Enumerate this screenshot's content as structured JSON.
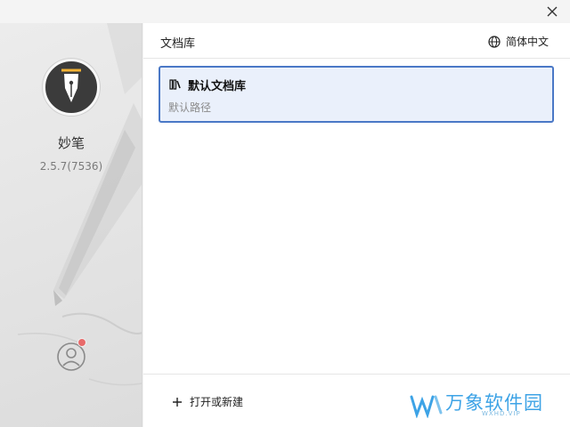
{
  "sidebar": {
    "app_name": "妙笔",
    "version": "2.5.7(7536)"
  },
  "header": {
    "title": "文档库",
    "language_label": "简体中文"
  },
  "repositories": [
    {
      "name": "默认文档库",
      "path": "默认路径",
      "selected": true
    }
  ],
  "footer": {
    "open_new_label": "打开或新建"
  },
  "watermark": {
    "brand": "万象软件园",
    "domain": "WXHD.VIP"
  },
  "colors": {
    "accent": "#4a78c6",
    "selected_bg": "#eaf0fb",
    "badge": "#e86a6a",
    "watermark": "#3da3e6"
  }
}
